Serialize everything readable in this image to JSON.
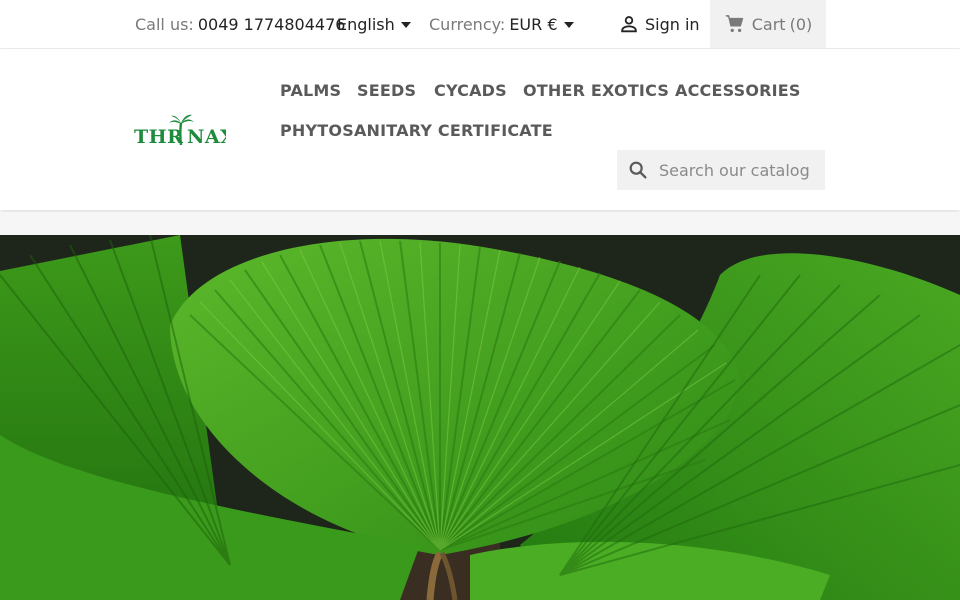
{
  "topbar": {
    "call_label": "Call us:",
    "phone": "0049 1774804476",
    "language": "English",
    "currency_label": "Currency:",
    "currency_value": "EUR €",
    "sign_in": "Sign in",
    "cart": "Cart",
    "cart_count": "(0)"
  },
  "header": {
    "logo_text": "THRINAX",
    "nav": [
      "PALMS",
      "SEEDS",
      "CYCADS",
      "OTHER EXOTICS",
      "ACCESSORIES",
      "PHYTOSANITARY CERTIFICATE"
    ],
    "search_placeholder": "Search our catalog"
  },
  "colors": {
    "logo_green": "#1d8a3c",
    "nav_text": "#5a5a5a",
    "leaf_green": "#3f9e1d"
  },
  "icons": {
    "user": "user-icon",
    "cart": "shopping-cart-icon",
    "search": "search-icon",
    "dropdown": "caret-down-icon"
  }
}
